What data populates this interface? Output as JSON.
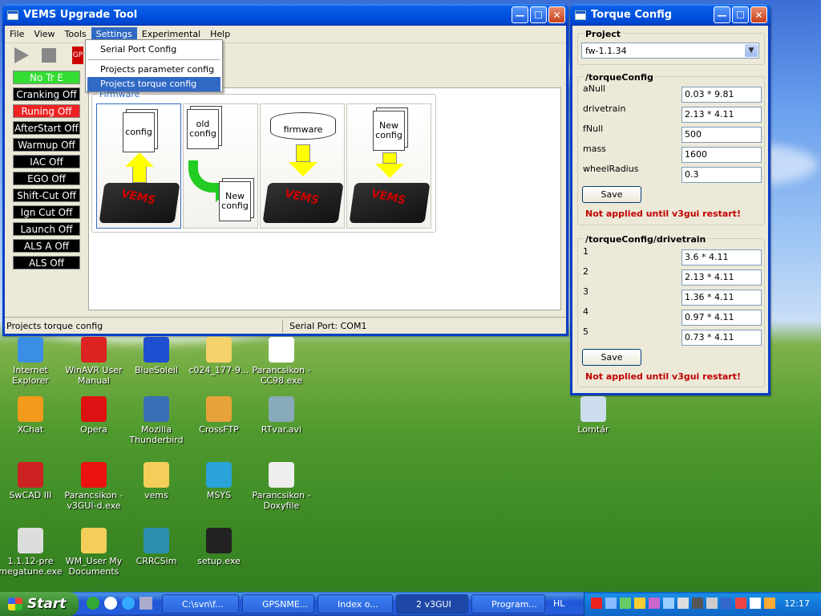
{
  "upgrade_window": {
    "title": "VEMS Upgrade Tool",
    "menu": [
      "File",
      "View",
      "Tools",
      "Settings",
      "Experimental",
      "Help"
    ],
    "active_menu": "Settings",
    "dropdown": [
      "Serial Port Config",
      "Projects parameter config",
      "Projects torque config"
    ],
    "dropdown_highlight": "Projects torque config",
    "status_labels": [
      {
        "text": "No Tr E",
        "bg": "#33dd33",
        "fg": "#ffffff"
      },
      {
        "text": "Cranking Off",
        "bg": "#000000",
        "fg": "#ffffff"
      },
      {
        "text": "Runing Off",
        "bg": "#ee2222",
        "fg": "#ffffff"
      },
      {
        "text": "AfterStart Off",
        "bg": "#000000",
        "fg": "#ffffff"
      },
      {
        "text": "Warmup Off",
        "bg": "#000000",
        "fg": "#ffffff"
      },
      {
        "text": "IAC Off",
        "bg": "#000000",
        "fg": "#ffffff"
      },
      {
        "text": "EGO Off",
        "bg": "#000000",
        "fg": "#ffffff"
      },
      {
        "text": "Shift-Cut Off",
        "bg": "#000000",
        "fg": "#ffffff"
      },
      {
        "text": "Ign Cut Off",
        "bg": "#000000",
        "fg": "#ffffff"
      },
      {
        "text": "Launch Off",
        "bg": "#000000",
        "fg": "#ffffff"
      },
      {
        "text": "ALS A Off",
        "bg": "#000000",
        "fg": "#ffffff"
      },
      {
        "text": "ALS Off",
        "bg": "#000000",
        "fg": "#ffffff"
      }
    ],
    "panel_title": "Firmware",
    "cards": {
      "card1_doc": "config",
      "card2_doc_old": "old config",
      "card2_doc_new": "New config",
      "card3_db": "firmware",
      "card4_doc": "New config"
    },
    "statusbar_left": "Projects torque config",
    "statusbar_right": "Serial Port: COM1"
  },
  "torque_window": {
    "title": "Torque Config",
    "project_label": "Project",
    "project_value": "fw-1.1.34",
    "group1_title": "/torqueConfig",
    "group1_fields": [
      {
        "label": "aNull",
        "value": "0.03 * 9.81"
      },
      {
        "label": "drivetrain",
        "value": "2.13 * 4.11"
      },
      {
        "label": "fNull",
        "value": "500"
      },
      {
        "label": "mass",
        "value": "1600"
      },
      {
        "label": "wheelRadius",
        "value": "0.3"
      }
    ],
    "save_label": "Save",
    "warning": "Not applied until v3gui restart!",
    "group2_title": "/torqueConfig/drivetrain",
    "group2_fields": [
      {
        "label": "1",
        "value": "3.6 * 4.11"
      },
      {
        "label": "2",
        "value": "2.13 * 4.11"
      },
      {
        "label": "3",
        "value": "1.36 * 4.11"
      },
      {
        "label": "4",
        "value": "0.97 * 4.11"
      },
      {
        "label": "5",
        "value": "0.73 * 4.11"
      }
    ]
  },
  "desktop_icons": [
    {
      "label": "Internet Explorer",
      "icon": "ie-icon"
    },
    {
      "label": "WinAVR User Manual",
      "icon": "pdf-icon"
    },
    {
      "label": "BlueSoleil",
      "icon": "bluetooth-icon"
    },
    {
      "label": "c024_177-9...",
      "icon": "file-icon"
    },
    {
      "label": "Parancsikon - CC98.exe",
      "icon": "shortcut-icon"
    },
    {
      "label": "XChat",
      "icon": "xchat-icon"
    },
    {
      "label": "Opera",
      "icon": "opera-icon"
    },
    {
      "label": "Mozilla Thunderbird",
      "icon": "thunderbird-icon"
    },
    {
      "label": "CrossFTP",
      "icon": "crossftp-icon"
    },
    {
      "label": "RTvar.avi",
      "icon": "video-icon"
    },
    {
      "label": "SwCAD III",
      "icon": "swcad-icon"
    },
    {
      "label": "Parancsikon - v3GUI-d.exe",
      "icon": "v3gui-icon"
    },
    {
      "label": "vems",
      "icon": "folder-icon"
    },
    {
      "label": "MSYS",
      "icon": "msys-icon"
    },
    {
      "label": "Parancsikon - Doxyfile",
      "icon": "doxyfile-icon"
    },
    {
      "label": "1.1.12-pre megatune.exe",
      "icon": "exe-icon"
    },
    {
      "label": "WM_User My Documents",
      "icon": "mydocs-icon"
    },
    {
      "label": "CRRCSim",
      "icon": "crrcsim-icon"
    },
    {
      "label": "setup.exe",
      "icon": "setup-icon"
    },
    {
      "label": "Lomtár",
      "icon": "recycle-bin-icon"
    }
  ],
  "taskbar": {
    "start": "Start",
    "items": [
      "C:\\svn\\f...",
      "GPSNME...",
      "Index o...",
      "2 v3GUI",
      "Program..."
    ],
    "lang": "HL",
    "clock": "12:17"
  }
}
